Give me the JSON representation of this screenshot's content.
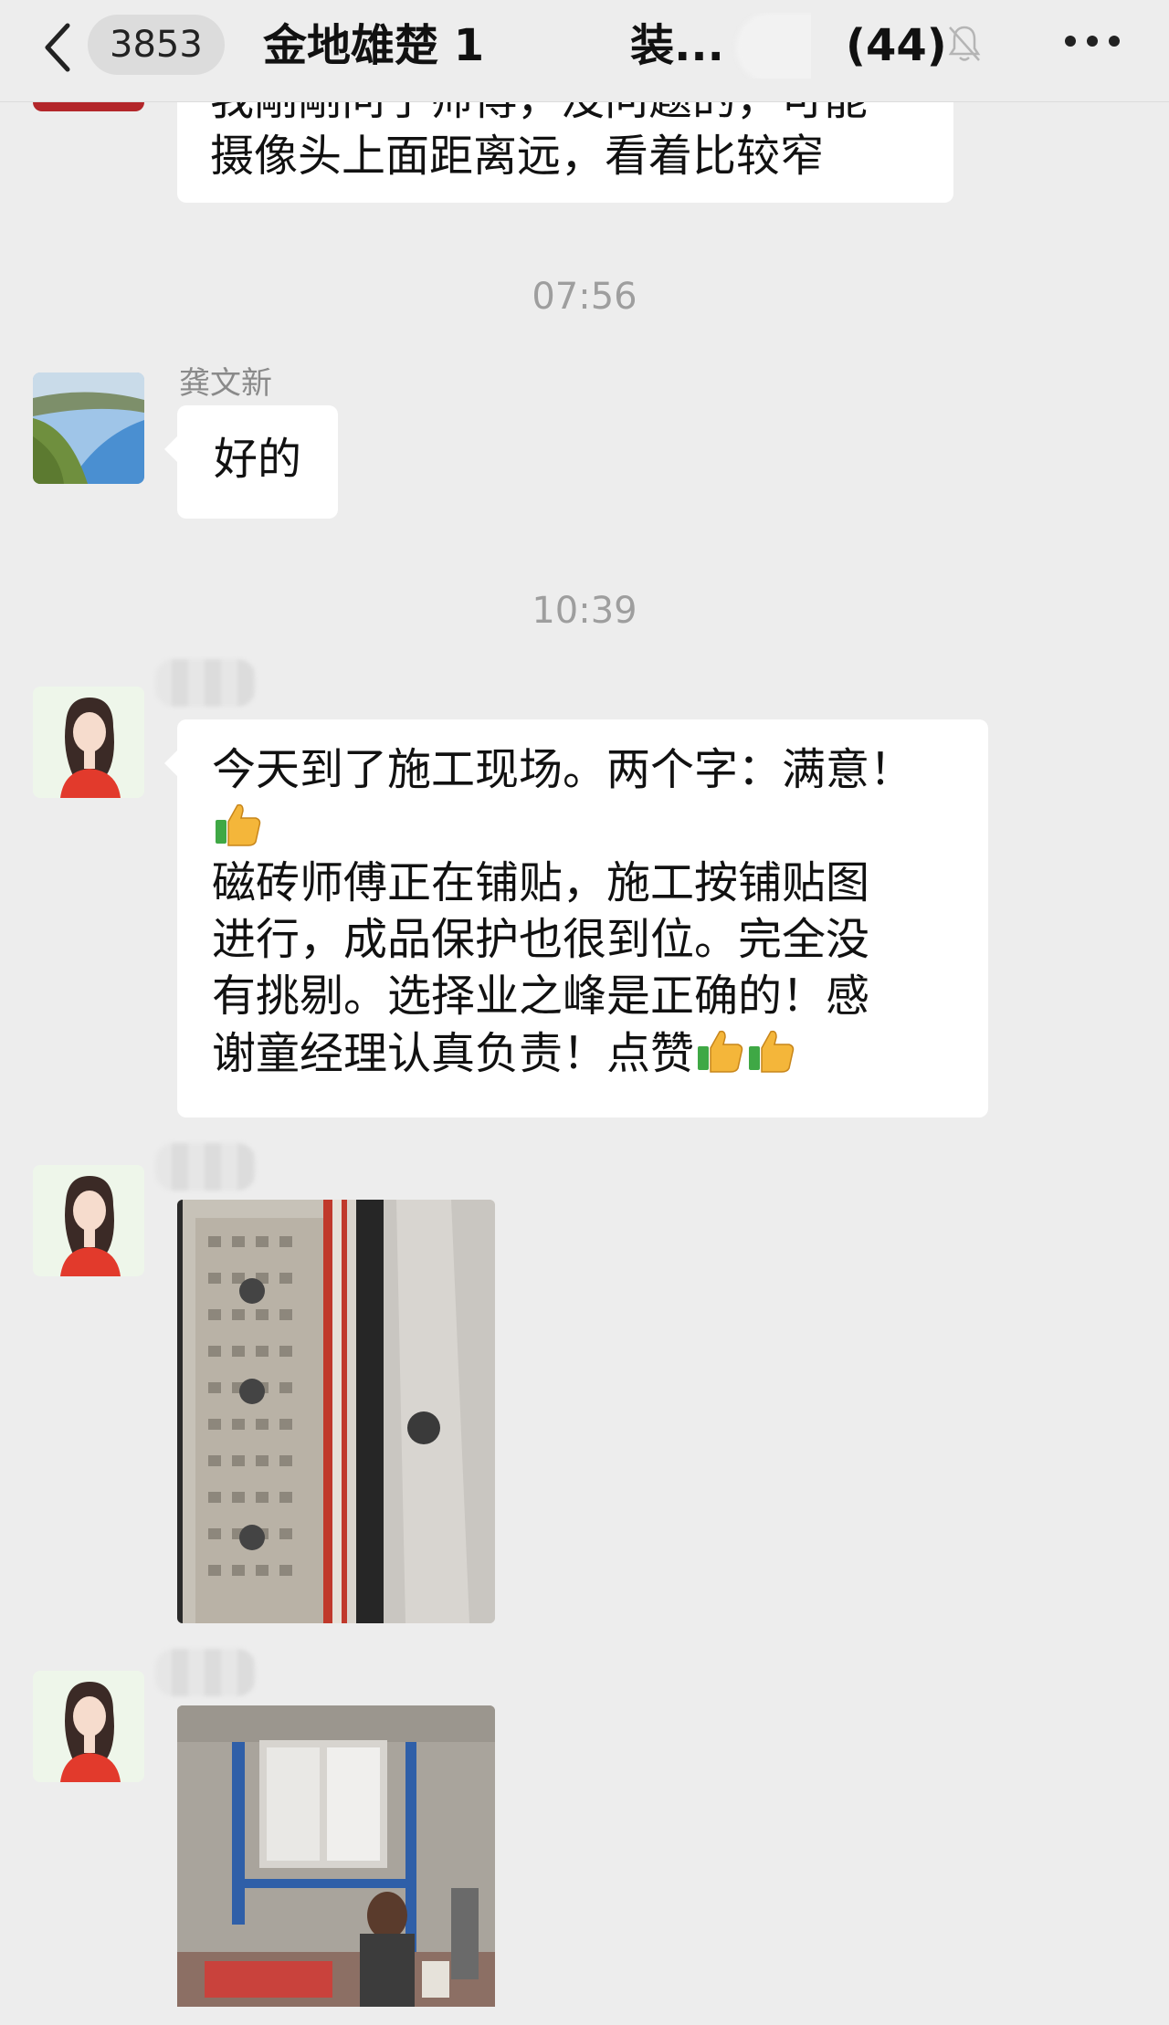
{
  "header": {
    "unread_count": "3853",
    "title": "金地雄楚 1",
    "title_suffix": "装...",
    "member_count": "(44)"
  },
  "messages": {
    "prev_text_line1": "我剛剛问了师傅，没问题的，可能",
    "prev_text_line2": "摄像头上面距离远，看着比较窄",
    "time_1": "07:56",
    "sender_1": "龚文新",
    "reply_1": "好的",
    "time_2": "10:39",
    "review_line1": "今天到了施工现场。两个字：满意！",
    "review_line2": "磁砖师傅正在铺贴，施工按铺贴图",
    "review_line3": "进行，成品保护也很到位。完全没",
    "review_line4": "有挑剔。选择业之峰是正确的！感",
    "review_line5": "谢童经理认真负责！点赞"
  },
  "icons": {
    "back": "chevron-left-icon",
    "mute": "bell-muted-icon",
    "more": "more-dots-icon",
    "thumbs_up": "thumbs-up-emoji"
  },
  "colors": {
    "background": "#ededed",
    "bubble": "#ffffff",
    "muted_text": "#9e9e9e"
  }
}
